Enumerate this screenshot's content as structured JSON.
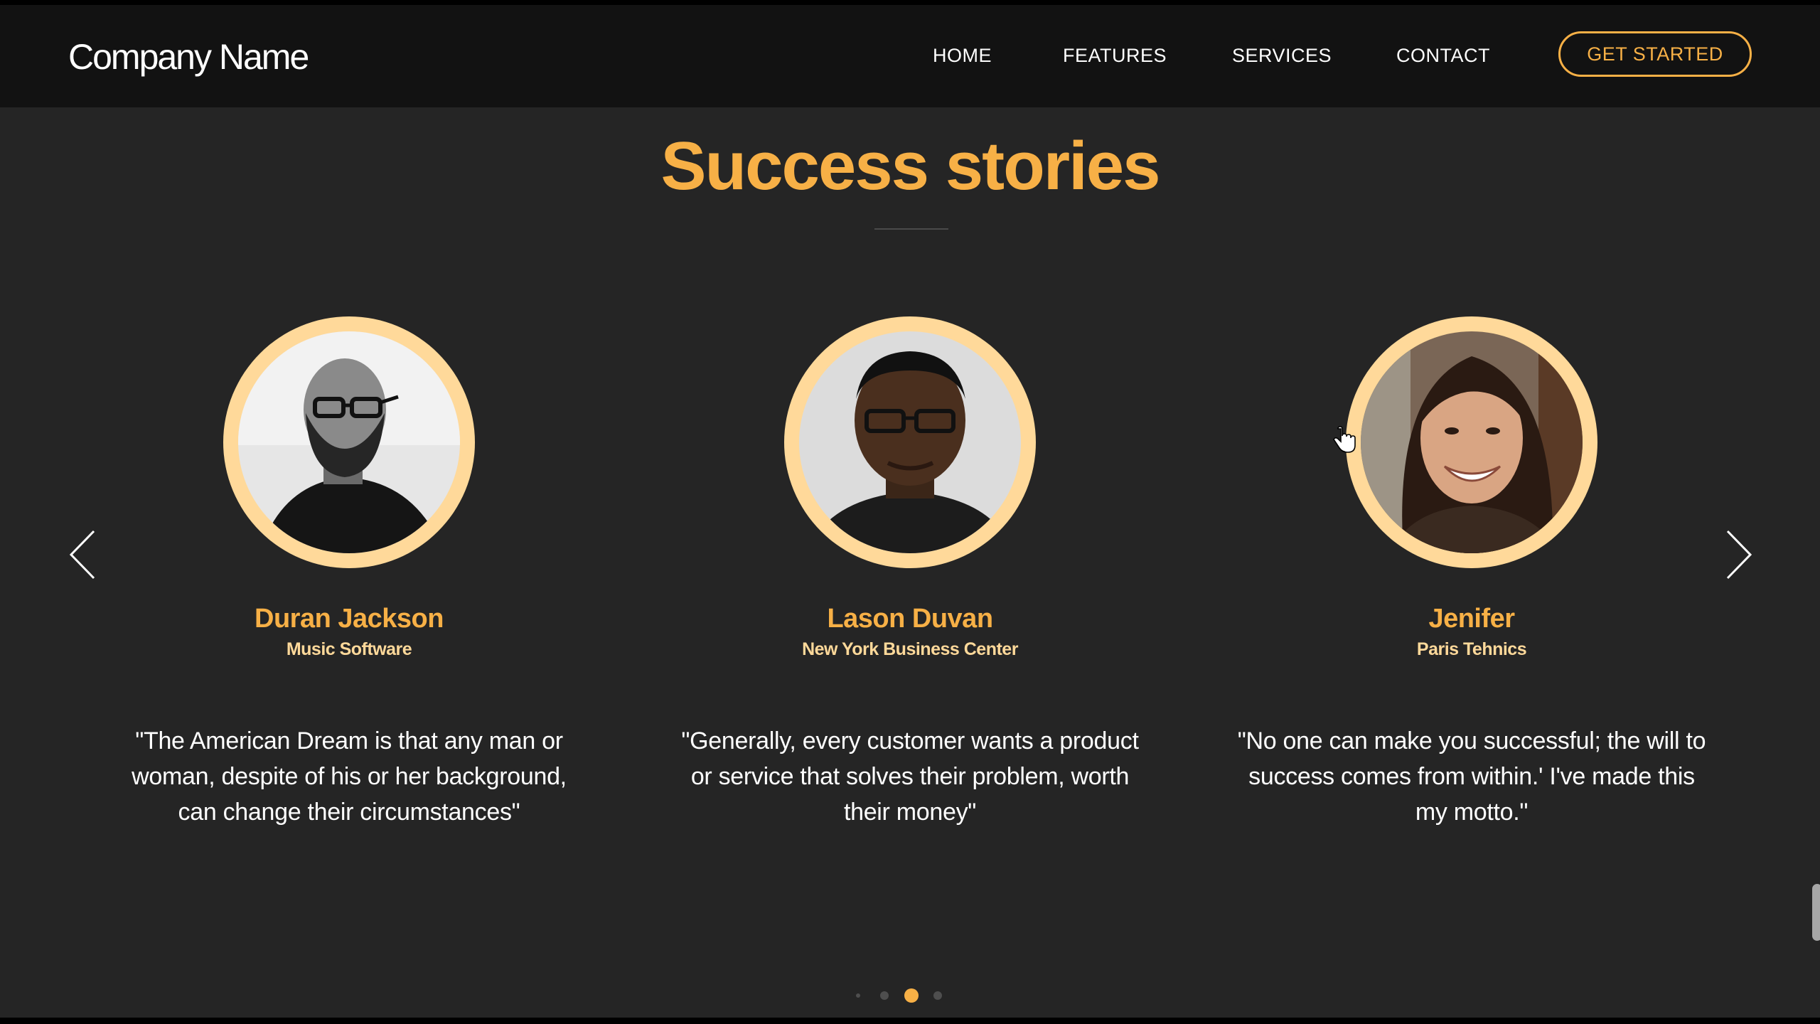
{
  "header": {
    "brand": "Company Name",
    "nav": [
      {
        "label": "HOME"
      },
      {
        "label": "FEATURES"
      },
      {
        "label": "SERVICES"
      },
      {
        "label": "CONTACT"
      }
    ],
    "cta_label": "GET STARTED"
  },
  "section": {
    "title": "Success stories"
  },
  "testimonials": [
    {
      "name": "Duran Jackson",
      "company": "Music Software",
      "quote": "\"The American Dream is that any man or woman, despite of his or her background, can change their circumstances\"",
      "photo_style": "grayscale"
    },
    {
      "name": "Lason Duvan",
      "company": "New York Business Center",
      "quote": "\"Generally, every customer wants a product or service that solves their problem, worth their money\"",
      "photo_style": "color"
    },
    {
      "name": "Jenifer",
      "company": "Paris Tehnics",
      "quote": "\"No one can make you successful; the will to success comes from within.' I've made this my motto.\"",
      "photo_style": "color"
    }
  ],
  "carousel": {
    "prev_icon": "chevron-left-icon",
    "next_icon": "chevron-right-icon",
    "dots_count": 4,
    "active_dot": 3
  },
  "colors": {
    "accent": "#f7b046",
    "accent_light": "#ffd99a",
    "background": "#252525",
    "navbar": "#121212",
    "text": "#ffffff"
  }
}
